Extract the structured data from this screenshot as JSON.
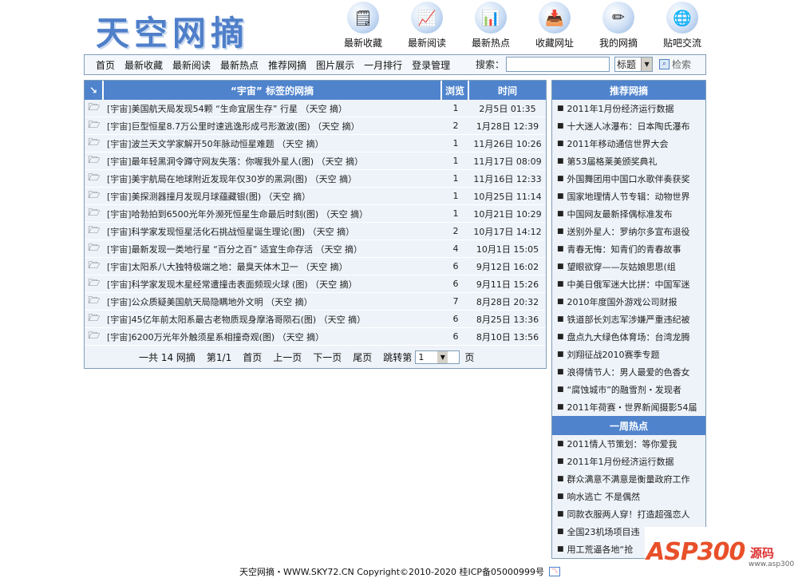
{
  "site": {
    "logo": "天空网摘"
  },
  "top_icons": [
    {
      "label": "最新收藏",
      "icon": "🗒"
    },
    {
      "label": "最新阅读",
      "icon": "📈"
    },
    {
      "label": "最新热点",
      "icon": "📊"
    },
    {
      "label": "收藏网址",
      "icon": "📥"
    },
    {
      "label": "我的网摘",
      "icon": "✏"
    },
    {
      "label": "贴吧交流",
      "icon": "🌐"
    }
  ],
  "nav": [
    "首页",
    "最新收藏",
    "最新阅读",
    "最新热点",
    "推荐网摘",
    "图片展示",
    "一月排行",
    "登录管理"
  ],
  "search": {
    "label": "搜索：",
    "value": "",
    "select_value": "标题",
    "button": "检索"
  },
  "list": {
    "header_title": "“宇宙” 标签的网摘",
    "header_views": "浏览",
    "header_time": "时间",
    "rows": [
      {
        "cat": "[宇宙]",
        "title": "美国航天局发现54颗 “生命宜居生存” 行星 （天空 摘）",
        "views": "1",
        "time": "2月5日 01:35"
      },
      {
        "cat": "[宇宙]",
        "title": "巨型恒星8.7万公里时速逃逸形成弓形激波(图) （天空 摘）",
        "views": "2",
        "time": "1月28日 12:39"
      },
      {
        "cat": "[宇宙]",
        "title": "波兰天文学家解开50年脉动恒星难题 （天空 摘）",
        "views": "1",
        "time": "11月26日 10:26"
      },
      {
        "cat": "[宇宙]",
        "title": "最年轻黑洞令蹲守网友失落：你喔我外星人(图) （天空 摘）",
        "views": "1",
        "time": "11月17日 08:09"
      },
      {
        "cat": "[宇宙]",
        "title": "美宇航局在地球附近发现年仅30岁的黑洞(图) （天空 摘）",
        "views": "1",
        "time": "11月16日 12:33"
      },
      {
        "cat": "[宇宙]",
        "title": "美探测器撞月发现月球蕴藏银(图) （天空 摘）",
        "views": "1",
        "time": "10月25日 11:14"
      },
      {
        "cat": "[宇宙]",
        "title": "哈勃拍到6500光年外濒死恒星生命最后时刻(图) （天空 摘）",
        "views": "1",
        "time": "10月21日 10:29"
      },
      {
        "cat": "[宇宙]",
        "title": "科学家发现恒星活化石挑战恒星诞生理论(图) （天空 摘）",
        "views": "2",
        "time": "10月17日 14:12"
      },
      {
        "cat": "[宇宙]",
        "title": "最新发现一类地行星 “百分之百” 适宜生命存活 （天空 摘）",
        "views": "4",
        "time": "10月1日 15:05"
      },
      {
        "cat": "[宇宙]",
        "title": "太阳系八大独特极端之地：最臭天体木卫一 （天空 摘）",
        "views": "6",
        "time": "9月12日 16:02"
      },
      {
        "cat": "[宇宙]",
        "title": "科学家发现木星经常遭撞击表面频现火球 (图) （天空 摘）",
        "views": "6",
        "time": "9月11日 15:26"
      },
      {
        "cat": "[宇宙]",
        "title": "公众质疑美国航天局隐瞒地外文明 （天空 摘）",
        "views": "7",
        "time": "8月28日 20:32"
      },
      {
        "cat": "[宇宙]",
        "title": "45亿年前太阳系最古老物质现身摩洛哥陨石(图) （天空 摘）",
        "views": "6",
        "time": "8月25日 13:36"
      },
      {
        "cat": "[宇宙]",
        "title": "6200万光年外触须星系相撞奇观(图) （天空 摘）",
        "views": "6",
        "time": "8月10日 13:56"
      }
    ]
  },
  "pager": {
    "total": "一共 14 网摘",
    "page": "第1/1",
    "first": "首页",
    "prev": "上一页",
    "next": "下一页",
    "last": "尾页",
    "jump_label": "跳转第",
    "jump_value": "1",
    "jump_unit": "页"
  },
  "recommend": {
    "title": "推荐网摘",
    "items": [
      "2011年1月份经济运行数据",
      "十大迷人冰瀑布：日本陶氏瀑布",
      "2011年移动通信世界大会",
      "第53届格莱美颁奖典礼",
      "外国舞团用中国口水歌伴奏获奖",
      "国家地理情人节专辑：动物世界",
      "中国网友最新择偶标准发布",
      "送别外星人：罗纳尔多宣布退役",
      "青春无悔：知青们的青春故事",
      "望眼欲穿——灰姑娘思思(组",
      "中美日俄军迷大比拼：中国军迷",
      "2010年度国外游戏公司财报",
      "铁道部长刘志军涉嫌严重违纪被",
      "盘点九大绿色体育场：台湾龙腾",
      "刘翔征战2010赛季专题",
      "浪得情节人：男人最爱的色香女",
      "“腐蚀城市”的融雪剂・发现者",
      "2011年荷赛・世界新闻摄影54届"
    ]
  },
  "weekly": {
    "title": "一周热点",
    "items": [
      "2011情人节策划：等你爱我",
      "2011年1月份经济运行数据",
      "群众满意不满意是衡量政府工作",
      "响水逃亡 不是偶然",
      "同款衣服两人穿！打造超强恋人",
      "全国23机场项目违",
      "用工荒逼各地“抢"
    ]
  },
  "footer": {
    "text": "天空网摘・WWW.SKY72.CN Copyright©2010-2020 桂ICP备05000999号"
  },
  "watermark": {
    "brand": "ASP300",
    "cn": "源码",
    "url": "www.asp300.com"
  }
}
